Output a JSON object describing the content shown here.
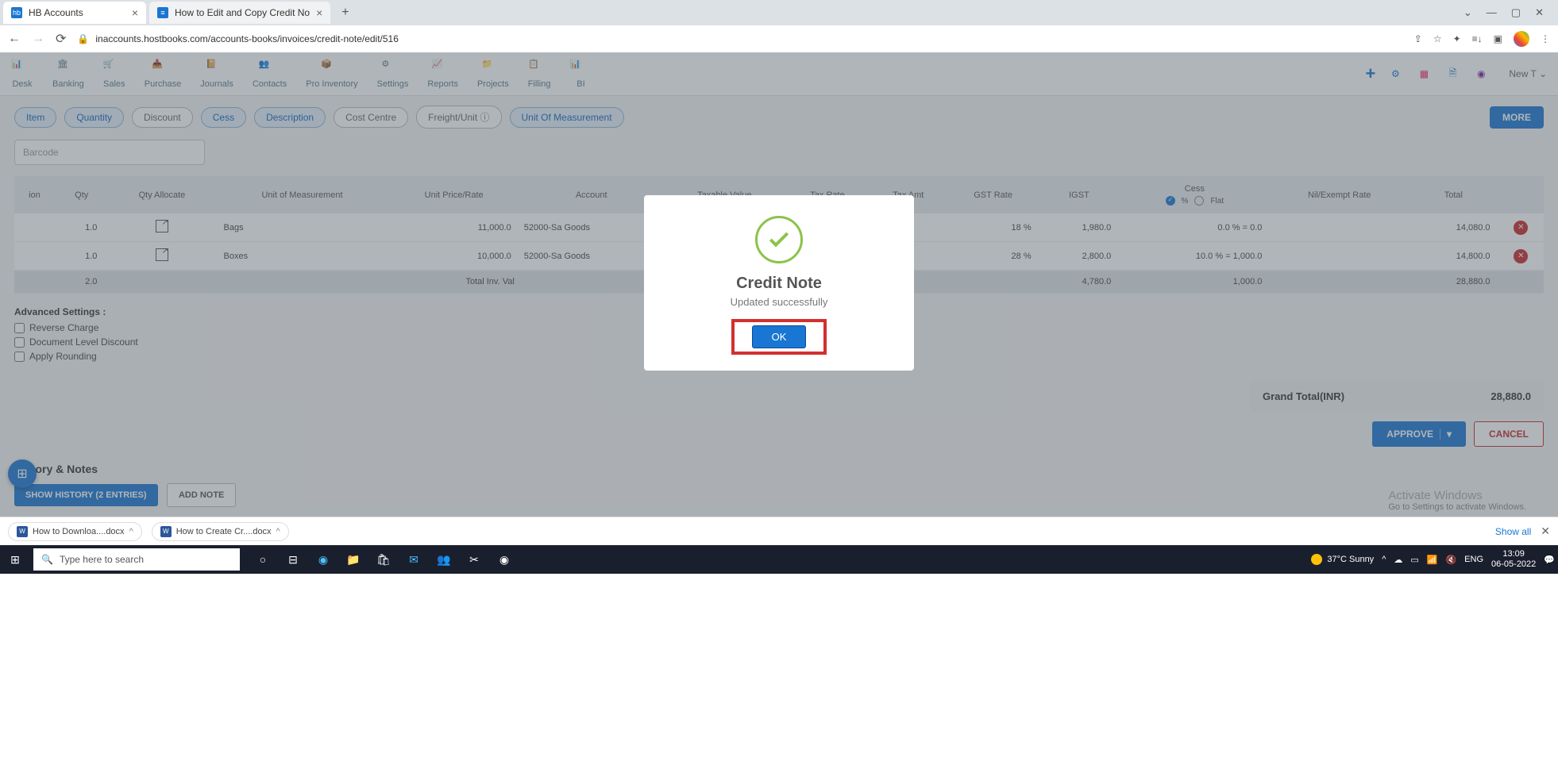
{
  "browser": {
    "tabs": [
      {
        "favicon_label": "hb",
        "title": "HB Accounts"
      },
      {
        "favicon_label": "≡",
        "title": "How to Edit and Copy Credit No"
      }
    ],
    "url": "inaccounts.hostbooks.com/accounts-books/invoices/credit-note/edit/516"
  },
  "nav": {
    "items": [
      "Desk",
      "Banking",
      "Sales",
      "Purchase",
      "Journals",
      "Contacts",
      "Pro Inventory",
      "Settings",
      "Reports",
      "Projects",
      "Filling",
      "BI"
    ],
    "new_t": "New T"
  },
  "chips": {
    "labels": [
      "Item",
      "Quantity",
      "Discount",
      "Cess",
      "Description",
      "Cost Centre",
      "Freight/Unit ⓘ",
      "Unit Of Measurement"
    ],
    "active": [
      true,
      true,
      false,
      true,
      true,
      false,
      false,
      true
    ],
    "more": "MORE"
  },
  "barcode_placeholder": "Barcode",
  "table": {
    "headers": [
      "ion",
      "Qty",
      "Qty Allocate",
      "Unit of Measurement",
      "Unit Price/Rate",
      "Account",
      "Taxable Value",
      "Tax Rate",
      "Tax Amt",
      "GST Rate",
      "IGST",
      "Cess",
      "Nil/Exempt Rate",
      "Total",
      ""
    ],
    "cess_label": "Cess",
    "cess_pct": "%",
    "cess_flat": "Flat",
    "rows": [
      {
        "qty": "1.0",
        "alloc_icon": true,
        "uom": "Bags",
        "rate": "11,000.0",
        "account": "52000-Sa Goods",
        "gst": "18 %",
        "igst": "1,980.0",
        "cess": "0.0 % = 0.0",
        "total": "14,080.0"
      },
      {
        "qty": "1.0",
        "alloc_icon": true,
        "uom": "Boxes",
        "rate": "10,000.0",
        "account": "52000-Sa Goods",
        "gst": "28 %",
        "igst": "2,800.0",
        "cess": "10.0 % = 1,000.0",
        "total": "14,800.0"
      }
    ],
    "totals": {
      "qty": "2.0",
      "label": "Total Inv. Val",
      "igst": "4,780.0",
      "cess": "1,000.0",
      "total": "28,880.0"
    }
  },
  "advanced": {
    "title": "Advanced Settings :",
    "items": [
      "Reverse Charge",
      "Document Level Discount",
      "Apply Rounding"
    ]
  },
  "grand_total": {
    "label": "Grand Total(INR)",
    "value": "28,880.0"
  },
  "actions": {
    "approve": "APPROVE",
    "cancel": "CANCEL"
  },
  "history": {
    "title": "History & Notes",
    "show": "SHOW HISTORY (2 ENTRIES)",
    "add": "ADD NOTE"
  },
  "watermark": {
    "title": "Activate Windows",
    "sub": "Go to Settings to activate Windows."
  },
  "modal": {
    "title": "Credit Note",
    "sub": "Updated successfully",
    "ok": "OK"
  },
  "downloads": {
    "items": [
      "How to Downloa....docx",
      "How to Create Cr....docx"
    ],
    "show_all": "Show all"
  },
  "taskbar": {
    "search_placeholder": "Type here to search",
    "weather": "37°C Sunny",
    "lang": "ENG",
    "time": "13:09",
    "date": "06-05-2022"
  }
}
